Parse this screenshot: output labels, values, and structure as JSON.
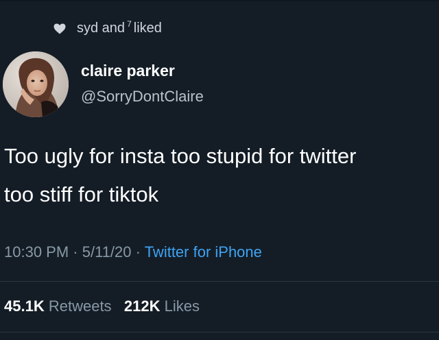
{
  "social_context": {
    "names": "syd and",
    "count": "7",
    "action": "liked",
    "icon": "heart-icon"
  },
  "author": {
    "display_name": "claire parker",
    "handle": "@SorryDontClaire"
  },
  "tweet": {
    "line1": "Too ugly for insta too stupid for twitter",
    "line2": "too stiff for tiktok"
  },
  "meta": {
    "time": "10:30 PM",
    "sep1": "·",
    "date": "5/11/20",
    "sep2": "·",
    "source": "Twitter for iPhone"
  },
  "stats": {
    "retweets_count": "45.1K",
    "retweets_label": "Retweets",
    "likes_count": "212K",
    "likes_label": "Likes"
  },
  "colors": {
    "background": "#141d26",
    "link": "#3fa4f4",
    "secondary_text": "#8899a6"
  }
}
